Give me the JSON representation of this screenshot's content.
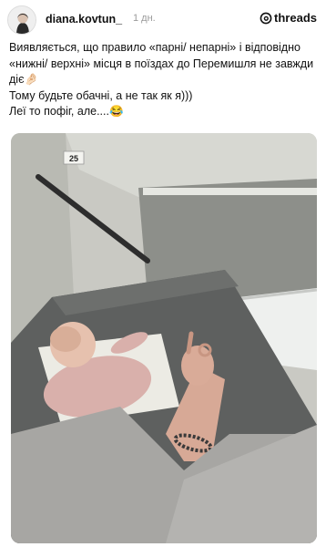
{
  "post": {
    "author": {
      "username": "diana.kovtun_",
      "avatar_icon": "profile-avatar-icon"
    },
    "time": "1 дн.",
    "brand": {
      "name": "threads",
      "icon": "threads-logo-icon"
    },
    "caption_lines": [
      "Виявляється, що правило «парні/ непарні» і відповідно «нижні/ верхні» місця в поїздах до Перемишля не завжди діє🤌🏻",
      "Тому будьте обачні, а не так як я)))",
      "Леї то пофіг, але....😂"
    ],
    "photo": {
      "berth_number": "25"
    }
  }
}
